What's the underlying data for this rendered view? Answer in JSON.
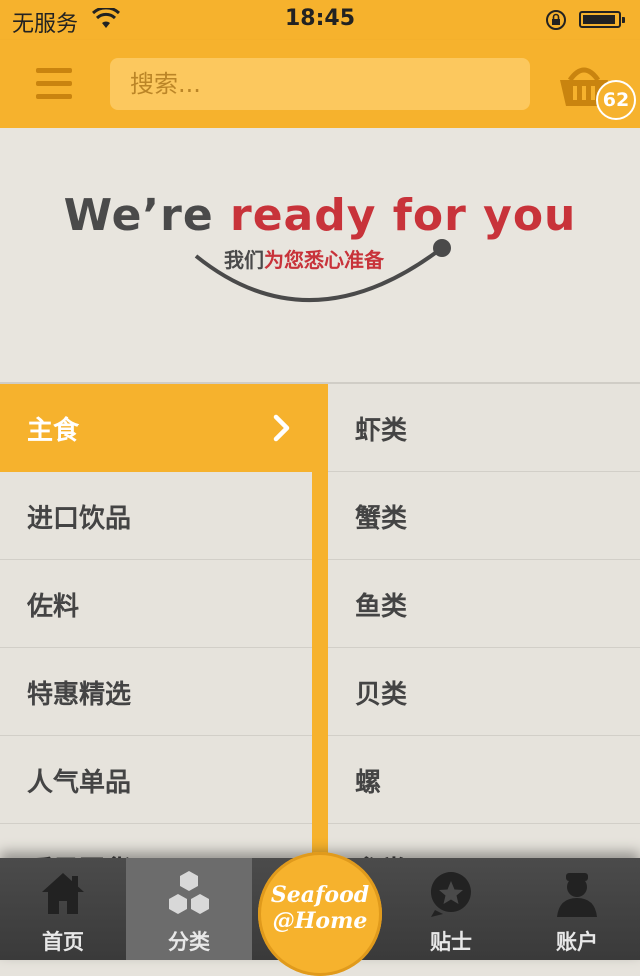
{
  "status_bar": {
    "carrier": "无服务",
    "time": "18:45"
  },
  "nav": {
    "search_placeholder": "搜索...",
    "cart_count": "62"
  },
  "banner": {
    "headline_dark": "We’re ",
    "headline_red": "ready for you",
    "sub_dark": "我们",
    "sub_red": "为您悉心准备"
  },
  "categories": {
    "left": [
      {
        "label": "主食",
        "active": true
      },
      {
        "label": "进口饮品"
      },
      {
        "label": "佐料"
      },
      {
        "label": "特惠精选"
      },
      {
        "label": "人气单品"
      },
      {
        "label": "暖风囤货"
      }
    ],
    "right": [
      {
        "label": "虾类"
      },
      {
        "label": "蟹类"
      },
      {
        "label": "鱼类"
      },
      {
        "label": "贝类"
      },
      {
        "label": "螺"
      },
      {
        "label": "参类"
      }
    ]
  },
  "tabbar": {
    "home": "首页",
    "category": "分类",
    "logo_line1": "Seafood",
    "logo_line2": "@Home",
    "tips": "贴士",
    "account": "账户"
  },
  "colors": {
    "accent": "#f6b22d",
    "background": "#e6e3dc",
    "red_text": "#c8333a",
    "tabbar": "#3f3f3f"
  }
}
